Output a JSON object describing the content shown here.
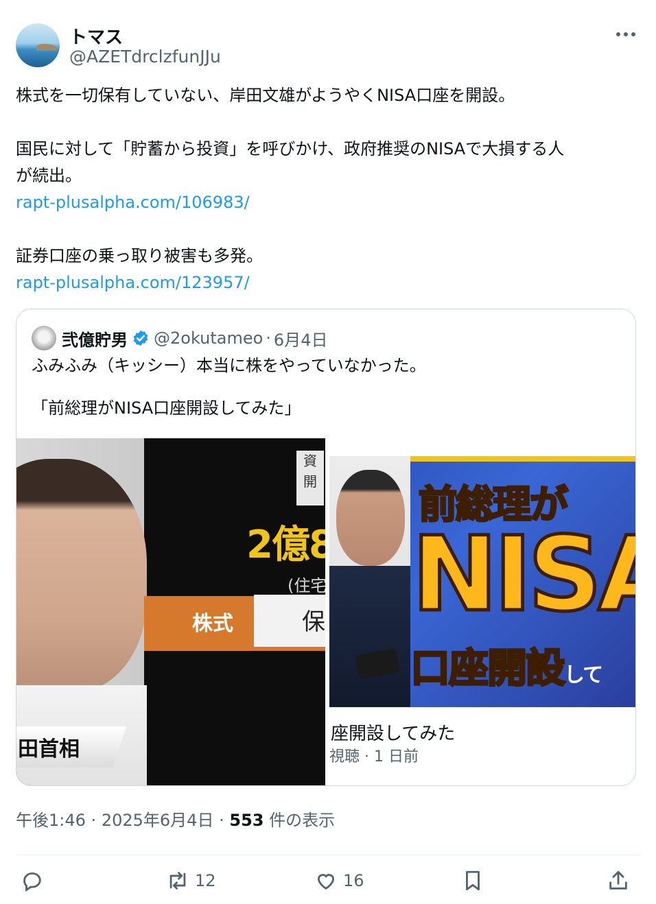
{
  "author": {
    "display_name": "トマス",
    "handle": "@AZETdrclzfunJJu"
  },
  "tweet": {
    "para1": "株式を一切保有していない、岸田文雄がようやくNISA口座を開設。",
    "para2_line1": "国民に対して「貯蓄から投資」を呼びかけ、政府推奨のNISAで大損する人",
    "para2_line2": "が続出。",
    "link1": "rapt-plusalpha.com/106983/",
    "para3": "証券口座の乗っ取り被害も多発。",
    "link2": "rapt-plusalpha.com/123957/"
  },
  "quote": {
    "name": "弐億貯男",
    "handle": "@2okutameo",
    "separator": "·",
    "date": "6月4日",
    "text1": "ふみふみ（キッシー）本当に株をやっていなかった。",
    "text2": "「前総理がNISA口座開設してみた」",
    "left_image": {
      "top_box": "資\n開",
      "amount": "2億8",
      "sub": "(住宅",
      "band_label": "株式",
      "band_value": "保",
      "name_tag": "田首相"
    },
    "right_image": {
      "title_top": "前総理が",
      "title_main": "NISA",
      "title_bottom": "口座開設",
      "title_bottom_small": "して"
    },
    "video_caption": "座開設してみた",
    "video_meta": "視聴 · 1 日前"
  },
  "meta": {
    "time": "午後1:46",
    "sep1": "·",
    "date": "2025年6月4日",
    "sep2": "·",
    "views": "553",
    "views_label": "件の表示"
  },
  "actions": {
    "retweets": "12",
    "likes": "16"
  },
  "colors": {
    "link": "#1d9bf0",
    "secondary": "#536471",
    "verified": "#1d9bf0"
  }
}
